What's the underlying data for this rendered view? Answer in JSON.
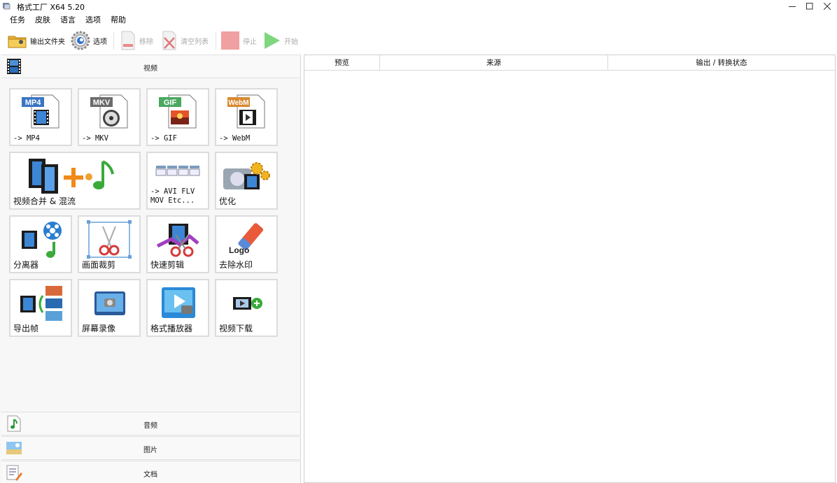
{
  "window": {
    "title": "格式工厂 X64 5.20"
  },
  "menu": [
    "任务",
    "皮肤",
    "语言",
    "选项",
    "帮助"
  ],
  "toolbar": {
    "output_folder": "输出文件夹",
    "options": "选项",
    "remove": "移除",
    "clear_list": "清空列表",
    "stop": "停止",
    "start": "开始"
  },
  "sections": {
    "video": "视频",
    "audio": "音频",
    "image": "图片",
    "document": "文档"
  },
  "tiles": {
    "mp4": "-> MP4",
    "mp4_badge": "MP4",
    "mkv": "-> MKV",
    "mkv_badge": "MKV",
    "gif": "-> GIF",
    "gif_badge": "GIF",
    "webm": "-> WebM",
    "webm_badge": "WebM",
    "merge": "视频合并 & 混流",
    "avi_line1": "-> AVI FLV",
    "avi_line2": "MOV Etc...",
    "optimize": "优化",
    "splitter": "分离器",
    "crop": "画面裁剪",
    "quick_clip": "快速剪辑",
    "remove_watermark": "去除水印",
    "logo_text": "Logo",
    "export_frames": "导出帧",
    "screen_record": "屏幕录像",
    "player": "格式播放器",
    "video_download": "视频下载"
  },
  "list": {
    "col_preview": "预览",
    "col_source": "来源",
    "col_status": "输出 / 转换状态"
  },
  "colors": {
    "accent_blue": "#3a74c4",
    "disabled_red": "#f0a0a0",
    "start_green": "#7ed67e",
    "panel_bg": "#f7f7f7"
  }
}
